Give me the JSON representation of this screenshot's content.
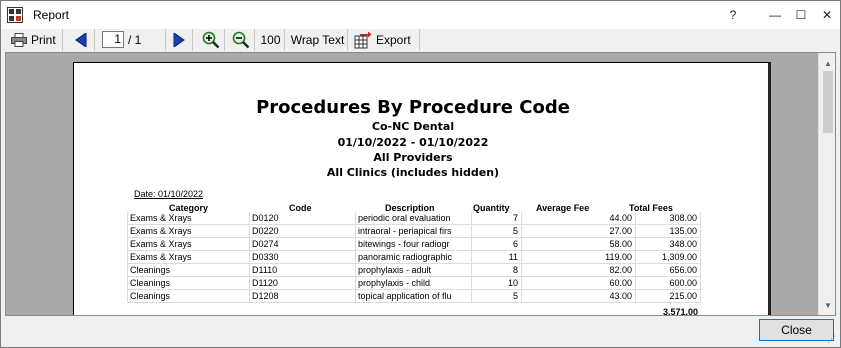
{
  "window": {
    "title": "Report"
  },
  "titlebar": {
    "help": "?",
    "minimize": "—",
    "maximize": "☐",
    "close": "✕"
  },
  "toolbar": {
    "print_label": "Print",
    "page_current": "1",
    "page_total": "/ 1",
    "zoom_value": "100",
    "wrap_label": "Wrap Text",
    "export_label": "Export"
  },
  "report": {
    "title": "Procedures By Procedure Code",
    "clinic": "Co-NC Dental",
    "date_range": "01/10/2022 - 01/10/2022",
    "providers": "All Providers",
    "clinics": "All Clinics (includes hidden)",
    "date_label": "Date: 01/10/2022",
    "columns": [
      "Category",
      "Code",
      "Description",
      "Quantity",
      "Average Fee",
      "Total Fees"
    ],
    "rows": [
      {
        "category": "Exams & Xrays",
        "code": "D0120",
        "description": "periodic oral evaluation",
        "quantity": "7",
        "avg_fee": "44.00",
        "total": "308.00"
      },
      {
        "category": "Exams & Xrays",
        "code": "D0220",
        "description": "intraoral  -  periapical firs",
        "quantity": "5",
        "avg_fee": "27.00",
        "total": "135.00"
      },
      {
        "category": "Exams & Xrays",
        "code": "D0274",
        "description": "bitewings  -  four radiogr",
        "quantity": "6",
        "avg_fee": "58.00",
        "total": "348.00"
      },
      {
        "category": "Exams & Xrays",
        "code": "D0330",
        "description": "panoramic radiographic",
        "quantity": "11",
        "avg_fee": "119.00",
        "total": "1,309.00"
      },
      {
        "category": "Cleanings",
        "code": "D1110",
        "description": "prophylaxis  -  adult",
        "quantity": "8",
        "avg_fee": "82.00",
        "total": "656.00"
      },
      {
        "category": "Cleanings",
        "code": "D1120",
        "description": "prophylaxis  -  child",
        "quantity": "10",
        "avg_fee": "60.00",
        "total": "600.00"
      },
      {
        "category": "Cleanings",
        "code": "D1208",
        "description": "topical  application  of flu",
        "quantity": "5",
        "avg_fee": "43.00",
        "total": "215.00"
      }
    ],
    "grand_total": "3,571.00"
  },
  "footer": {
    "close_label": "Close"
  },
  "icons": {
    "app": "grid-icon",
    "print": "printer-icon",
    "prev": "arrow-left-icon",
    "next": "arrow-right-icon",
    "zoom_in": "zoom-in-icon",
    "zoom_out": "zoom-out-icon",
    "export": "spreadsheet-export-icon"
  },
  "colors": {
    "nav_arrow": "#1a3fb4",
    "export_arrow": "#d02020",
    "close_border": "#0078d7"
  }
}
